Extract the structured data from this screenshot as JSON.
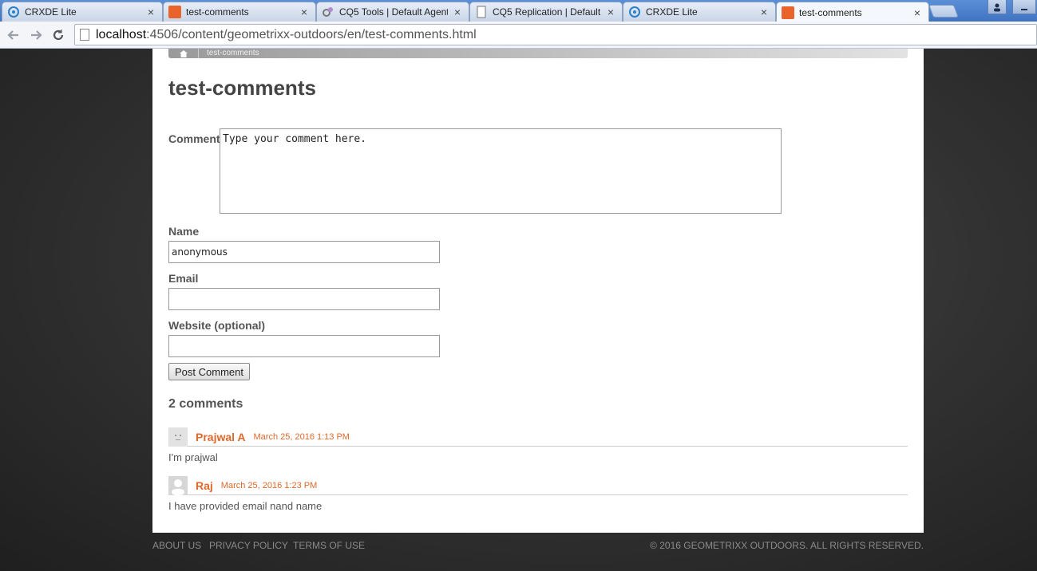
{
  "browser": {
    "tabs": [
      {
        "label": "CRXDE Lite",
        "icon": "crxde-icon"
      },
      {
        "label": "test-comments",
        "icon": "geometrixx-icon"
      },
      {
        "label": "CQ5 Tools | Default Agent",
        "icon": "tools-icon"
      },
      {
        "label": "CQ5 Replication | Default",
        "icon": "page-icon"
      },
      {
        "label": "CRXDE Lite",
        "icon": "crxde-icon"
      },
      {
        "label": "test-comments",
        "icon": "geometrixx-icon"
      }
    ],
    "close_glyph": "×",
    "url_host": "localhost",
    "url_rest": ":4506/content/geometrixx-outdoors/en/test-comments.html"
  },
  "breadcrumb": {
    "current": "test-comments"
  },
  "page": {
    "title": "test-comments"
  },
  "form": {
    "comment_label": "Comment",
    "comment_placeholder": "Type your comment here.",
    "name_label": "Name",
    "name_value": "anonymous",
    "email_label": "Email",
    "email_value": "",
    "website_label": "Website (optional)",
    "website_value": "",
    "submit_label": "Post Comment"
  },
  "comments": {
    "count_label": "2 comments",
    "items": [
      {
        "author": "Prajwal A",
        "date": "March 25, 2016 1:13 PM",
        "text": "I'm prajwal"
      },
      {
        "author": "Raj",
        "date": "March 25, 2016 1:23 PM",
        "text": "I have provided email nand name"
      }
    ]
  },
  "footer": {
    "links": [
      "ABOUT US",
      "PRIVACY POLICY",
      "TERMS OF USE"
    ],
    "copyright": "© 2016 GEOMETRIXX OUTDOORS. ALL RIGHTS RESERVED."
  },
  "colors": {
    "accent": "#e0682a",
    "tabbar": "#4a80cc"
  }
}
